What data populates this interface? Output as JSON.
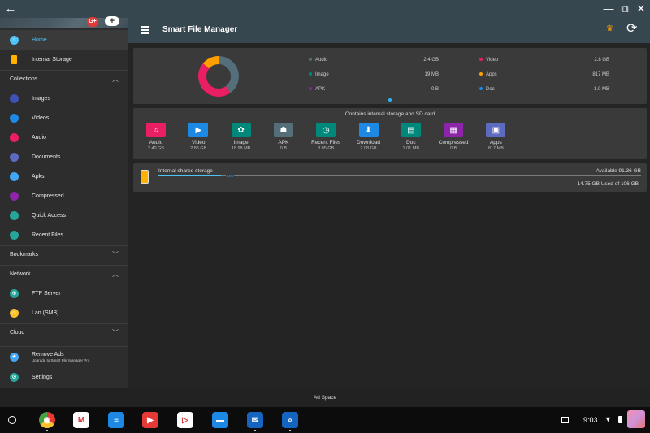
{
  "window": {
    "back_glyph": "←",
    "minimize_glyph": "—",
    "restore_glyph": "⧉",
    "close_glyph": "✕"
  },
  "drawer": {
    "account_google": "G+",
    "account_add": "+",
    "items": [
      {
        "label": "Home",
        "icon": "home-icon",
        "color": "#4fc3f7"
      },
      {
        "label": "Internal Storage",
        "icon": "phone-icon",
        "color": "#ffb300"
      }
    ],
    "collections_title": "Collections",
    "collections": [
      {
        "label": "Images",
        "icon": "images-icon",
        "color": "#3f51b5"
      },
      {
        "label": "Videos",
        "icon": "videos-icon",
        "color": "#1e88e5"
      },
      {
        "label": "Audio",
        "icon": "audio-icon",
        "color": "#e91e63"
      },
      {
        "label": "Documents",
        "icon": "documents-icon",
        "color": "#5c6bc0"
      },
      {
        "label": "Apks",
        "icon": "apks-icon",
        "color": "#42a5f5"
      },
      {
        "label": "Compressed",
        "icon": "compressed-icon",
        "color": "#8e24aa"
      },
      {
        "label": "Quick Access",
        "icon": "star-icon",
        "color": "#26a69a"
      },
      {
        "label": "Recent Files",
        "icon": "clock-icon",
        "color": "#26a69a"
      }
    ],
    "bookmarks_title": "Bookmarks",
    "network_title": "Network",
    "network": [
      {
        "label": "FTP Server",
        "icon": "ftp-icon",
        "color": "#26a69a"
      },
      {
        "label": "Lan (SMB)",
        "icon": "lan-icon",
        "color": "#fbc02d"
      }
    ],
    "cloud_title": "Cloud",
    "remove_ads": "Remove Ads",
    "remove_ads_sub": "Upgrade to Smart File Manager Pro",
    "settings": "Settings"
  },
  "toolbar": {
    "title": "Smart File Manager"
  },
  "storage_summary": {
    "legend": [
      {
        "label": "Audio",
        "value": "2.4 GB",
        "color": "#546e7a"
      },
      {
        "label": "Video",
        "value": "2.8 GB",
        "color": "#e91e63"
      },
      {
        "label": "Image",
        "value": "19 MB",
        "color": "#00897b"
      },
      {
        "label": "Apps",
        "value": "817 MB",
        "color": "#ffa000"
      },
      {
        "label": "APK",
        "value": "0 B",
        "color": "#8e24aa"
      },
      {
        "label": "Doc",
        "value": "1.0 MB",
        "color": "#1e88e5"
      }
    ],
    "donut_segments": [
      {
        "name": "Video",
        "fraction": 0.46,
        "color": "#e91e63"
      },
      {
        "name": "Audio",
        "fraction": 0.4,
        "color": "#546e7a"
      },
      {
        "name": "Apps",
        "fraction": 0.14,
        "color": "#ffa000"
      }
    ]
  },
  "categories": {
    "header": "Contains internal storage and SD card",
    "items": [
      {
        "name": "Audio",
        "size": "2.40 GB",
        "color": "#e91e63",
        "glyph": "♫",
        "icon": "audio-folder-icon"
      },
      {
        "name": "Video",
        "size": "2.85 GB",
        "color": "#1e88e5",
        "glyph": "▶",
        "icon": "video-folder-icon"
      },
      {
        "name": "Image",
        "size": "18.98 MB",
        "color": "#00897b",
        "glyph": "✿",
        "icon": "image-folder-icon"
      },
      {
        "name": "APK",
        "size": "0 B",
        "color": "#546e7a",
        "glyph": "☗",
        "icon": "apk-folder-icon"
      },
      {
        "name": "Recent Files",
        "size": "3.05 GB",
        "color": "#00897b",
        "glyph": "◷",
        "icon": "recent-folder-icon"
      },
      {
        "name": "Download",
        "size": "2.08 GB",
        "color": "#1e88e5",
        "glyph": "⬇",
        "icon": "download-folder-icon"
      },
      {
        "name": "Doc",
        "size": "1.01 MB",
        "color": "#00897b",
        "glyph": "▤",
        "icon": "doc-folder-icon"
      },
      {
        "name": "Compressed",
        "size": "0 B",
        "color": "#8e24aa",
        "glyph": "▦",
        "icon": "compressed-folder-icon"
      },
      {
        "name": "Apps",
        "size": "817 MB",
        "color": "#5c6bc0",
        "glyph": "▣",
        "icon": "apps-folder-icon"
      }
    ]
  },
  "internal_storage": {
    "title": "Internal shared storage",
    "available": "Available 91.36 GB",
    "percent_label": "13%",
    "used_fraction": 0.13,
    "used": "14.75 GB Used of 106 GB"
  },
  "ad_space": "Ad Space",
  "taskbar": {
    "time": "9:03",
    "apps": [
      {
        "name": "chrome-icon",
        "color": "#4caf50",
        "glyph": "◉",
        "active": true
      },
      {
        "name": "gmail-icon",
        "color": "#ffffff",
        "glyph": "M",
        "active": false
      },
      {
        "name": "docs-icon",
        "color": "#1e88e5",
        "glyph": "≡",
        "active": false
      },
      {
        "name": "youtube-icon",
        "color": "#e53935",
        "glyph": "▶",
        "active": false
      },
      {
        "name": "play-store-icon",
        "color": "#ffffff",
        "glyph": "▷",
        "active": false
      },
      {
        "name": "files-icon",
        "color": "#1e88e5",
        "glyph": "▬",
        "active": false
      },
      {
        "name": "inbox-icon",
        "color": "#1565c0",
        "glyph": "✉",
        "active": true
      },
      {
        "name": "file-manager-icon",
        "color": "#1565c0",
        "glyph": "⌕",
        "active": true
      }
    ]
  }
}
